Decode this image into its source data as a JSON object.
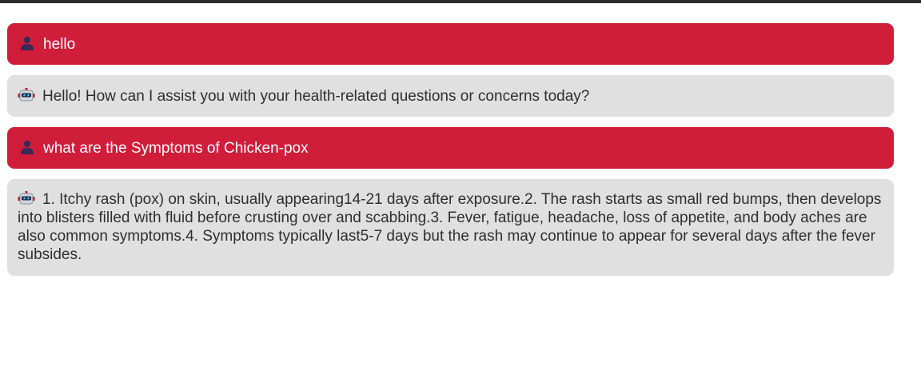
{
  "colors": {
    "user_bubble": "#cf1d3a",
    "bot_bubble": "#e0e0e0",
    "user_text": "#ffffff",
    "bot_text": "#2f2f2f"
  },
  "icons": {
    "user": "user-person-icon",
    "bot": "robot-icon"
  },
  "messages": [
    {
      "role": "user",
      "text": "hello"
    },
    {
      "role": "bot",
      "text": "Hello! How can I assist you with your health-related questions or concerns today?"
    },
    {
      "role": "user",
      "text": "what are the Symptoms of Chicken-pox"
    },
    {
      "role": "bot",
      "text": "1. Itchy rash (pox) on skin, usually appearing14-21 days after exposure.2. The rash starts as small red bumps, then develops into blisters filled with fluid before crusting over and scabbing.3. Fever, fatigue, headache, loss of appetite, and body aches are also common symptoms.4. Symptoms typically last5-7 days but the rash may continue to appear for several days after the fever subsides."
    }
  ]
}
